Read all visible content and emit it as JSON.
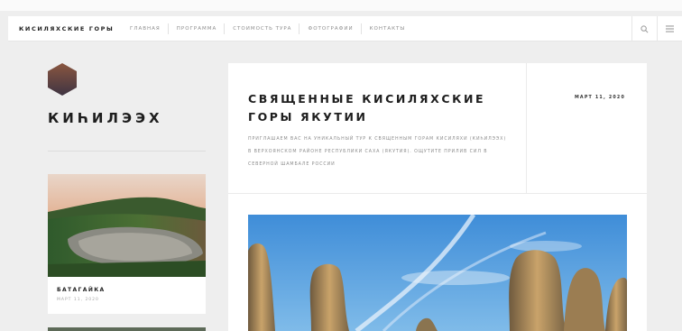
{
  "window": {
    "top_caption": ""
  },
  "navbar": {
    "brand": "КИСИЛЯХСКИЕ ГОРЫ",
    "links": [
      {
        "label": "ГЛАВНАЯ"
      },
      {
        "label": "ПРОГРАММА"
      },
      {
        "label": "СТОИМОСТЬ ТУРА"
      },
      {
        "label": "ФОТОГРАФИИ"
      },
      {
        "label": "КОНТАКТЫ"
      }
    ],
    "tools": {
      "search_icon": "search-icon",
      "menu_icon": "menu-icon"
    }
  },
  "sidebar": {
    "logo_icon": "hexagon-logo-icon",
    "logo_colors": [
      "#7d4f3c",
      "#4a3a45"
    ],
    "site_title": "КИҺИЛЭЭХ",
    "cards": [
      {
        "title": "БАТАГАЙКА",
        "date": "МАРТ 11, 2020"
      }
    ]
  },
  "article": {
    "title": "СВЯЩЕННЫЕ КИСИЛЯХСКИЕ ГОРЫ ЯКУТИИ",
    "description": "ПРИГЛАШАЕМ ВАС НА УНИКАЛЬНЫЙ ТУР К СВЯЩЕННЫМ ГОРАМ КИСИЛЯХИ (КИҺИЛЭЭХ) В ВЕРХОЯНСКОМ РАЙОНЕ РЕСПУБЛИКИ САХА (ЯКУТИЯ). ОЩУТИТЕ ПРИЛИВ СИЛ В СЕВЕРНОЙ ШАМБАЛЕ РОССИИ",
    "date": "МАРТ 11, 2020"
  },
  "colors": {
    "page_bg": "#eeeeee",
    "card_bg": "#ffffff",
    "text_dark": "#1e1e1e",
    "text_muted": "#8d8d8d"
  }
}
